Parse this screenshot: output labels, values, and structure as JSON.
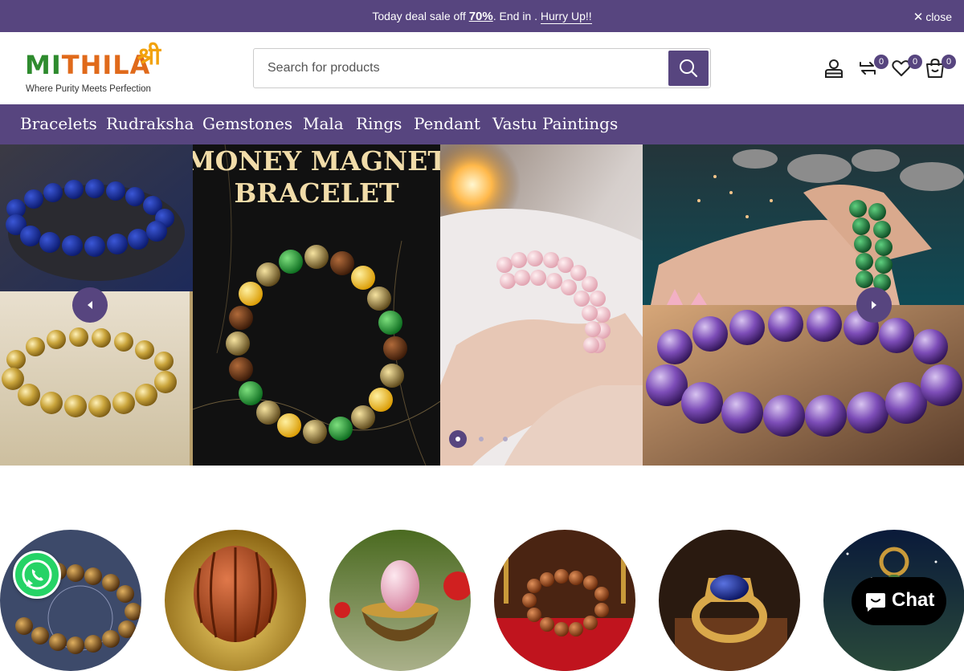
{
  "announcement": {
    "prefix": "Today deal sale off",
    "percent": "70%",
    "middle": ". End in .",
    "cta": "Hurry Up!!",
    "close_label": "close"
  },
  "header": {
    "logo": {
      "brand": "MITHILA",
      "mark": "श्री",
      "tagline": "Where Purity Meets Perfection"
    },
    "search": {
      "placeholder": "Search for products",
      "value": ""
    },
    "icons": [
      "account-icon",
      "compare-icon",
      "wishlist-icon",
      "cart-icon"
    ],
    "compare_count": "0",
    "wishlist_count": "0",
    "cart_count": "0"
  },
  "nav": {
    "items": [
      "Bracelets",
      "Rudraksha",
      "Gemstones",
      "Mala",
      "Rings",
      "Pendant",
      "Vastu Paintings"
    ]
  },
  "hero": {
    "title_line1": "MONEY MAGNET",
    "title_line2": "BRACELET",
    "slides": 3,
    "active_slide": 1
  },
  "categories": {
    "images": [
      "tiger-eye-bracelet",
      "rudraksha-bead",
      "rose-quartz-egg",
      "rudraksha-mala",
      "gemstone-ring",
      "pendant"
    ]
  },
  "widgets": {
    "chat_label": "Chat"
  },
  "colors": {
    "brand": "#57457f",
    "whatsapp": "#25d366"
  }
}
